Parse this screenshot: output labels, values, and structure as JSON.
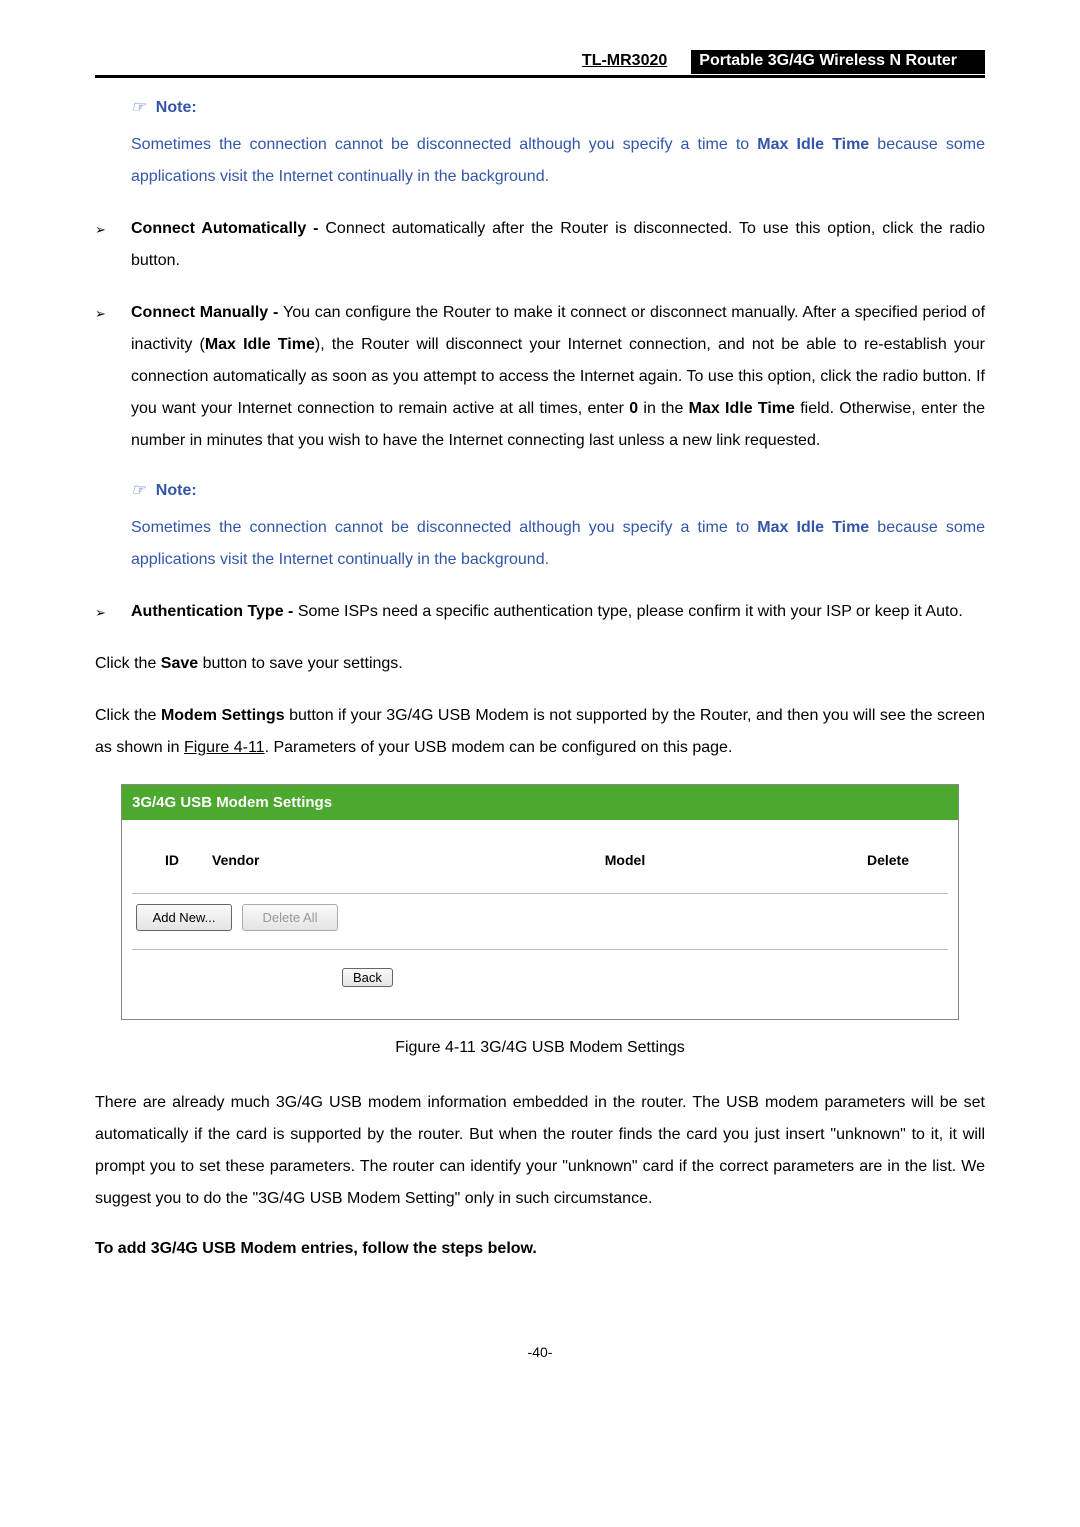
{
  "header": {
    "model": "TL-MR3020",
    "title": "Portable 3G/4G Wireless N Router"
  },
  "note1": {
    "label": "Note:",
    "body_prefix": "Sometimes the connection cannot be disconnected although you specify a time to ",
    "bold": "Max Idle Time",
    "body_suffix": " because some applications visit the Internet continually in the background."
  },
  "bullet_auto": {
    "bold": "Connect Automatically - ",
    "text": "Connect automatically after the Router is disconnected. To use this option, click the radio button."
  },
  "bullet_manual": {
    "bold": "Connect  Manually  - ",
    "part1": "You  can  configure  the  Router  to  make  it  connect  or  disconnect manually. After a specified period of inactivity (",
    "bold2": "Max Idle Time",
    "part2": "), the Router will disconnect your Internet connection, and not be able to re-establish your connection automatically as soon as you attempt to access the Internet again. To use this option, click the radio button. If you want your Internet connection to remain active at all times, enter ",
    "bold3": "0",
    "part3": " in the ",
    "bold4": "Max Idle Time",
    "part4": " field. Otherwise, enter the number in minutes that you wish to have the Internet connecting last unless a new link requested."
  },
  "note2": {
    "label": "Note:",
    "body_prefix": "Sometimes the connection cannot be disconnected although you specify a time to ",
    "bold": "Max Idle Time",
    "body_suffix": " because some applications visit the Internet continually in the background."
  },
  "bullet_auth": {
    "bold": "Authentication Type - ",
    "text": "Some ISPs need a specific authentication type, please confirm it with your ISP or keep it Auto."
  },
  "para_save": {
    "p1": "Click the ",
    "b1": "Save",
    "p2": " button to save your settings."
  },
  "para_modem": {
    "p1": "Click the ",
    "b1": "Modem Settings",
    "p2": " button if your 3G/4G USB Modem is not supported by the Router, and then you will see the screen as shown in ",
    "link": "Figure 4-11",
    "p3": ". Parameters of your USB modem can be configured on this page."
  },
  "figure": {
    "title": "3G/4G USB Modem Settings",
    "col_id": "ID",
    "col_vendor": "Vendor",
    "col_model": "Model",
    "col_delete": "Delete",
    "btn_add": "Add New...",
    "btn_delete_all": "Delete All",
    "btn_back": "Back",
    "caption": "Figure 4-11    3G/4G USB Modem Settings"
  },
  "para_after": "There are already much 3G/4G USB modem information embedded in the router. The USB modem parameters will be set automatically if the card is supported by the router. But when the router finds the card you just insert \"unknown\" to it, it will prompt you to set these parameters. The router can identify your \"unknown\" card if the correct parameters are in the list. We suggest you to do the \"3G/4G USB Modem Setting\" only in such circumstance.",
  "add_heading": "To add 3G/4G USB Modem entries, follow the steps below.",
  "footer": "-40-"
}
